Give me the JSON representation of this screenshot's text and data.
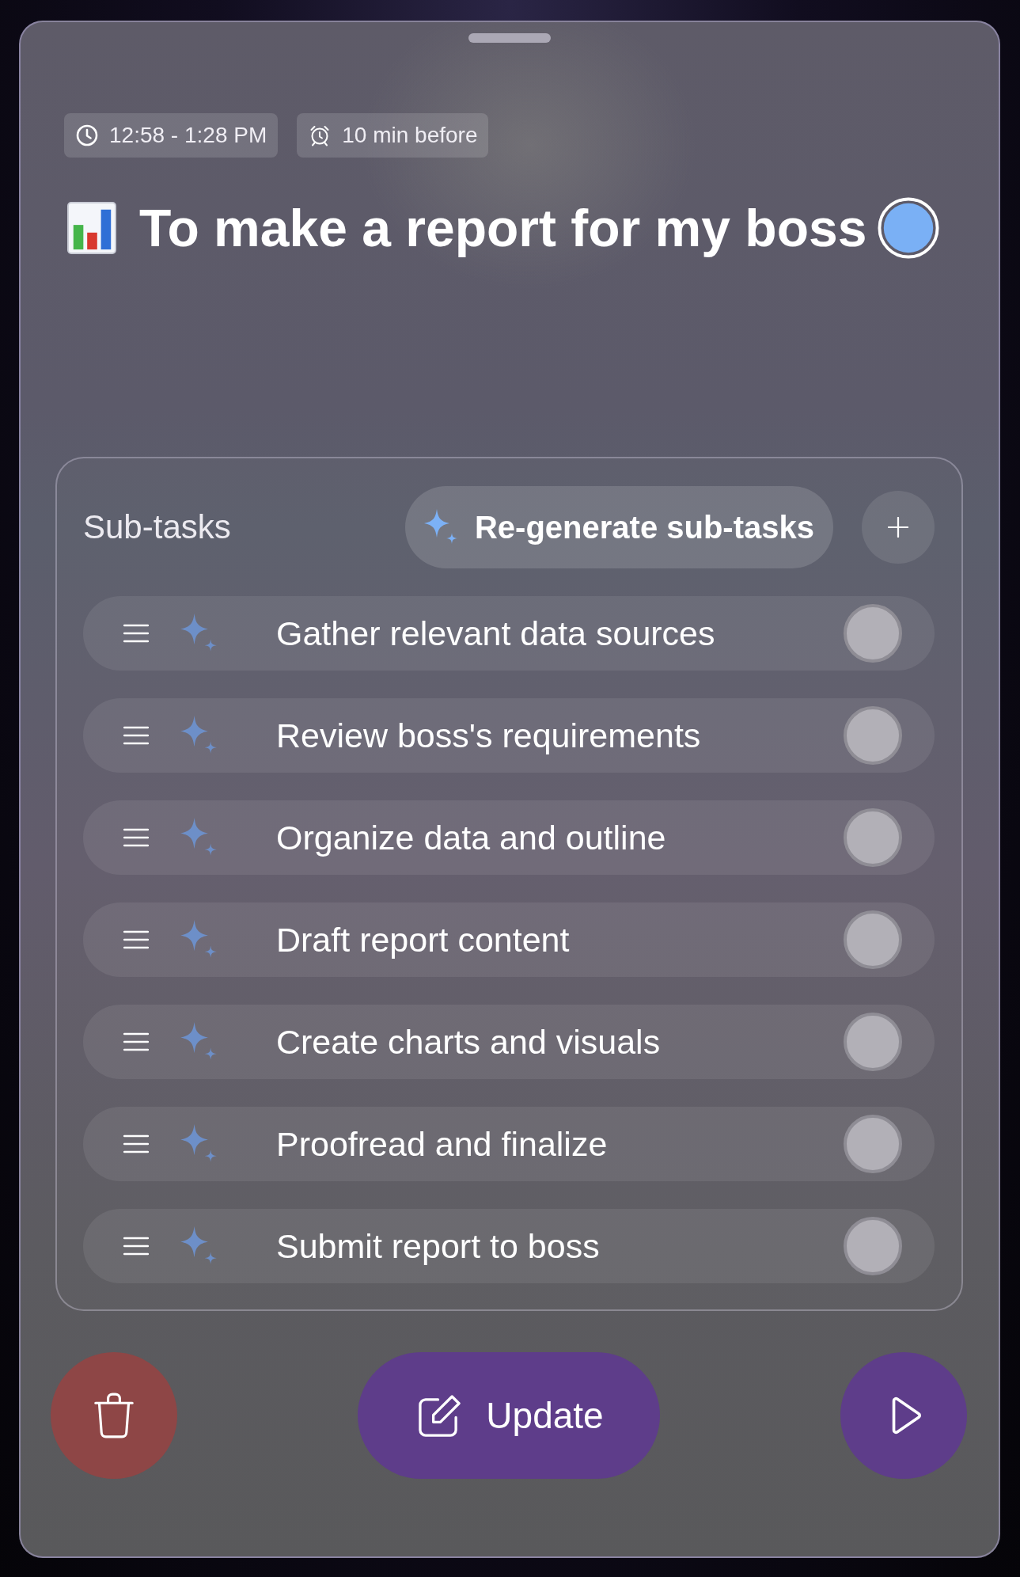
{
  "chips": [
    {
      "kind": "time",
      "label": "12:58 - 1:28 PM"
    },
    {
      "kind": "reminder",
      "label": "10 min before"
    }
  ],
  "task": {
    "title": "To make a report for my boss"
  },
  "subtasks": {
    "title": "Sub-tasks",
    "regenerate_label": "Re-generate sub-tasks",
    "items": [
      {
        "label": "Gather relevant data sources",
        "checked": false
      },
      {
        "label": "Review boss's requirements",
        "checked": false
      },
      {
        "label": "Organize data and outline",
        "checked": false
      },
      {
        "label": "Draft report content",
        "checked": false
      },
      {
        "label": "Create charts and visuals",
        "checked": false
      },
      {
        "label": "Proofread and finalize",
        "checked": false
      },
      {
        "label": "Submit report to boss",
        "checked": false
      }
    ]
  },
  "actions": {
    "update_label": "Update"
  }
}
